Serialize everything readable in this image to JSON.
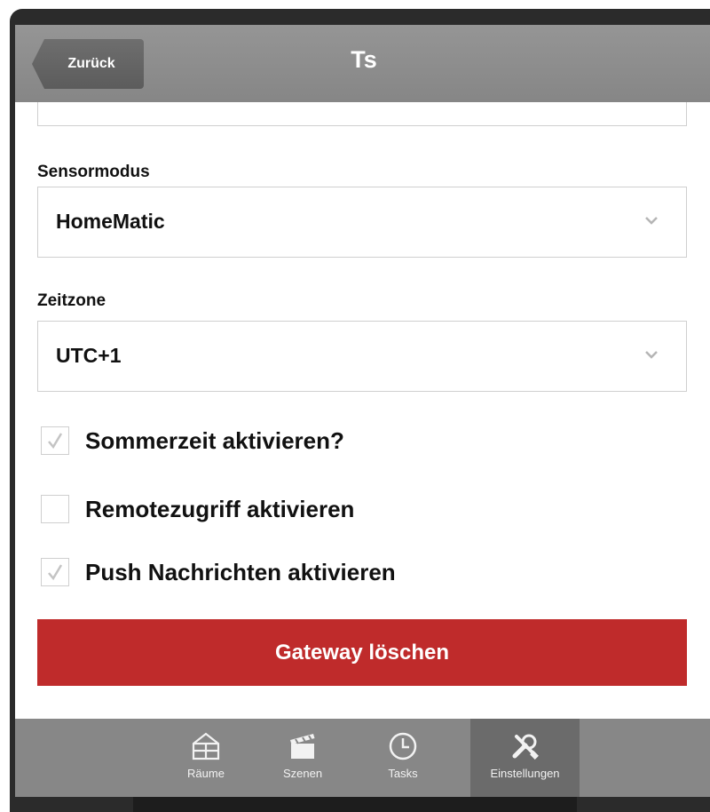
{
  "header": {
    "back_label": "Zurück",
    "title": "Ts"
  },
  "form": {
    "sensormodus": {
      "label": "Sensormodus",
      "value": "HomeMatic"
    },
    "zeitzone": {
      "label": "Zeitzone",
      "value": "UTC+1"
    },
    "checkboxes": [
      {
        "label": "Sommerzeit aktivieren?",
        "checked": true
      },
      {
        "label": "Remotezugriff aktivieren",
        "checked": false
      },
      {
        "label": "Push Nachrichten aktivieren",
        "checked": true
      }
    ],
    "delete_button": "Gateway löschen"
  },
  "tabbar": {
    "tabs": [
      {
        "label": "Räume",
        "icon": "house-grid-icon",
        "active": false
      },
      {
        "label": "Szenen",
        "icon": "clapperboard-icon",
        "active": false
      },
      {
        "label": "Tasks",
        "icon": "clock-icon",
        "active": false
      },
      {
        "label": "Einstellungen",
        "icon": "wrench-screwdriver-icon",
        "active": true
      }
    ]
  },
  "colors": {
    "header": "#8e8e8e",
    "back_button": "#666666",
    "delete_button": "#bf2b2b",
    "tabbar": "#878787",
    "tab_active": "#6b6b6b"
  }
}
